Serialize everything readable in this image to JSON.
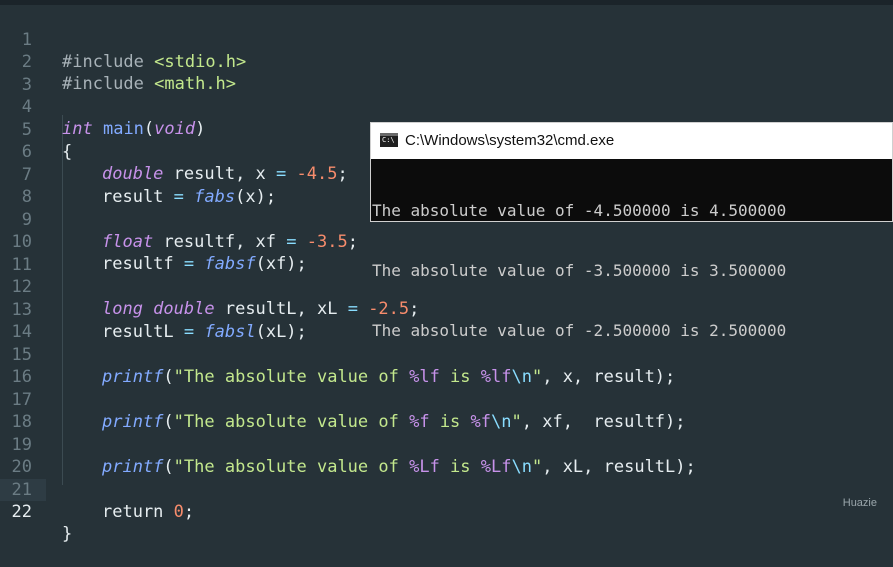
{
  "editor": {
    "active_line": 22,
    "line_numbers": [
      "1",
      "2",
      "3",
      "4",
      "5",
      "6",
      "7",
      "8",
      "9",
      "10",
      "11",
      "12",
      "13",
      "14",
      "15",
      "16",
      "17",
      "18",
      "19",
      "20",
      "21",
      "22"
    ],
    "l1": {
      "directive": "#include",
      "header": "<stdio.h>"
    },
    "l2": {
      "directive": "#include",
      "header": "<math.h>"
    },
    "l4": {
      "type": "int",
      "name": "main",
      "open": "(",
      "param": "void",
      "close": ")"
    },
    "l5": {
      "brace": "{"
    },
    "l6": {
      "type": "double",
      "id": "result, x",
      "op": "=",
      "num": "-4.5",
      "end": ";"
    },
    "l7": {
      "id": "result",
      "op": "=",
      "fn": "fabs",
      "args": "(x);"
    },
    "l9": {
      "type": "float",
      "id": "resultf, xf",
      "op": "=",
      "num": "-3.5",
      "end": ";"
    },
    "l10": {
      "id": "resultf",
      "op": "=",
      "fn": "fabsf",
      "args": "(xf);"
    },
    "l12": {
      "type": "long double",
      "id": "resultL, xL",
      "op": "=",
      "num": "-2.5",
      "end": ";"
    },
    "l13": {
      "id": "resultL",
      "op": "=",
      "fn": "fabsl",
      "args": "(xL);"
    },
    "l15": {
      "fn": "printf",
      "open": "(",
      "q1": "\"",
      "s1": "The absolute value of ",
      "f1": "%lf",
      "s2": " is ",
      "f2": "%lf",
      "esc": "\\n",
      "q2": "\"",
      "rest": ", x, result);"
    },
    "l17": {
      "fn": "printf",
      "open": "(",
      "q1": "\"",
      "s1": "The absolute value of ",
      "f1": "%f",
      "s2": " is ",
      "f2": "%f",
      "esc": "\\n",
      "q2": "\"",
      "rest": ", xf,  resultf);"
    },
    "l19": {
      "fn": "printf",
      "open": "(",
      "q1": "\"",
      "s1": "The absolute value of ",
      "f1": "%Lf",
      "s2": " is ",
      "f2": "%Lf",
      "esc": "\\n",
      "q2": "\"",
      "rest": ", xL, resultL);"
    },
    "l21": {
      "kw": "return",
      "num": "0",
      "end": ";"
    },
    "l22": {
      "brace": "}"
    }
  },
  "cmd": {
    "icon_text": "C:\\",
    "title": "C:\\Windows\\system32\\cmd.exe",
    "output": [
      "The absolute value of -4.500000 is 4.500000",
      "The absolute value of -3.500000 is 3.500000",
      "The absolute value of -2.500000 is 2.500000"
    ]
  },
  "watermark": "Huazie",
  "colors": {
    "background": "#263238",
    "keyword_type": "#c792ea",
    "function": "#82aaff",
    "number": "#f78c6c",
    "string": "#c3e88d",
    "terminal_bg": "#0c0c0c"
  }
}
